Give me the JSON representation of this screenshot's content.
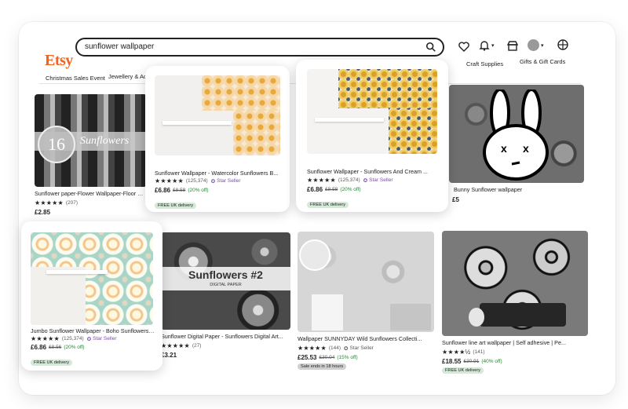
{
  "header": {
    "logo": "Etsy",
    "search_value": "sunflower wallpaper"
  },
  "nav": {
    "items": [
      "Christmas Sales Event",
      "Jewellery & Acce",
      "Craft Supplies",
      "Gifts & Gift Cards"
    ]
  },
  "listings": [
    {
      "title": "Sunflower paper-Flower Wallpaper-Floor Pap",
      "stars": "★★★★★",
      "reviews": "(207)",
      "price": "£2.85"
    },
    {
      "title": "Sunflower Wallpaper - Watercolor Sunflowers B...",
      "stars": "★★★★★",
      "reviews": "(125,374)",
      "star_seller": "Star Seller",
      "price": "£6.86",
      "original": "£8.58",
      "discount": "(20% off)",
      "badge": "FREE UK delivery"
    },
    {
      "title": "Sunflower Wallpaper - Sunflowers And Cream ...",
      "stars": "★★★★★",
      "reviews": "(125,374)",
      "star_seller": "Star Seller",
      "price": "£6.86",
      "original": "£8.58",
      "discount": "(20% off)",
      "badge": "FREE UK delivery"
    },
    {
      "title": "Bunny Sunflower wallpaper",
      "price": "£5"
    },
    {
      "title": "Jumbo Sunflower Wallpaper - Boho Sunflowers ...",
      "stars": "★★★★★",
      "reviews": "(125,374)",
      "star_seller": "Star Seller",
      "price": "£6.86",
      "original": "£8.56",
      "discount": "(20% off)",
      "badge": "FREE UK delivery"
    },
    {
      "title": "Sunflower Digital Paper - Sunflowers Digital Art...",
      "stars": "★★★★★",
      "reviews": "(27)",
      "price": "£3.21"
    },
    {
      "title": "Wallpaper SUNNYDAY Wild Sunflowers Collecti...",
      "stars": "★★★★★",
      "reviews": "(144)",
      "star_seller": "Star Seller",
      "price": "£25.53",
      "original": "£30.04",
      "discount": "(15% off)",
      "badge": "Sale ends in 18 hours"
    },
    {
      "title": "Sunflower line art wallpaper | Self adhesive | Pe...",
      "stars": "★★★★½",
      "reviews": "(141)",
      "price": "£18.55",
      "original": "£30.91",
      "discount": "(40% off)",
      "badge": "FREE UK delivery"
    }
  ],
  "image_text": {
    "sixteen": "16",
    "sunflowers": "Sunflowers",
    "sunflowers2": "Sunflowers #2",
    "digital_paper": "DIGITAL PAPER"
  },
  "colors": {
    "brand": "#f1641e",
    "star_seller": "#7b4bb5",
    "discount": "#258635"
  }
}
